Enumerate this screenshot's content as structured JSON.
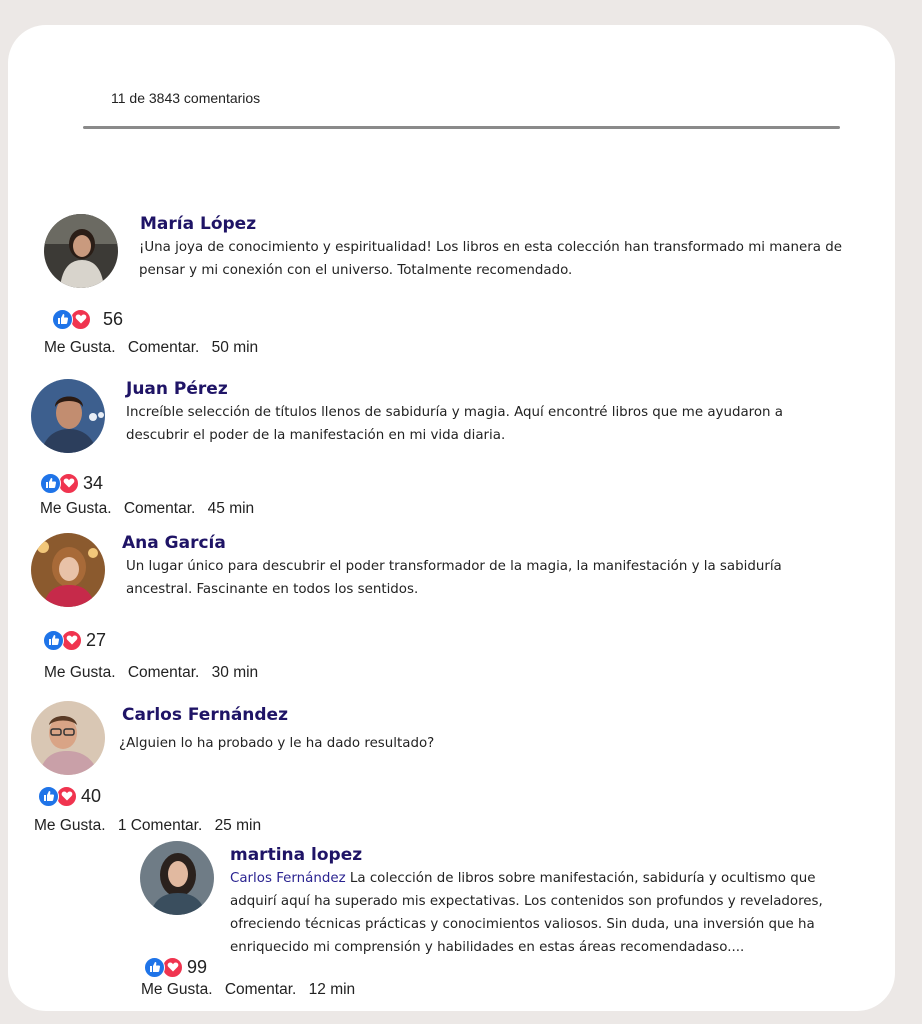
{
  "header": {
    "count_text": "11 de 3843 comentarios"
  },
  "icons": {
    "like": "thumbs-up-icon",
    "love": "heart-icon"
  },
  "colors": {
    "name": "#1f1466",
    "like": "#1f74e8",
    "love": "#f0344f",
    "background": "#ece8e6"
  },
  "comments": [
    {
      "name": "María López",
      "text": "¡Una joya de conocimiento y espiritualidad! Los libros en esta colección han transformado mi manera de pensar y mi conexión con el universo. Totalmente recomendado.",
      "reactions": "56",
      "like": "Me Gusta.",
      "comment": "Comentar.",
      "time": "50 min"
    },
    {
      "name": "Juan Pérez",
      "text": "Increíble selección de títulos llenos de sabiduría y magia. Aquí encontré libros que me ayudaron a descubrir el poder de la manifestación en mi vida diaria.",
      "reactions": "34",
      "like": "Me Gusta.",
      "comment": "Comentar.",
      "time": "45 min"
    },
    {
      "name": "Ana García",
      "text": "Un lugar único para descubrir el poder transformador de la magia, la manifestación y la sabiduría ancestral. Fascinante en todos los sentidos.",
      "reactions": "27",
      "like": "Me Gusta.",
      "comment": "Comentar.",
      "time": "30 min"
    },
    {
      "name": "Carlos Fernández",
      "text": "¿Alguien lo ha probado y le ha dado resultado?",
      "reactions": "40",
      "like": "Me Gusta.",
      "comment": "1 Comentar.",
      "time": "25 min"
    }
  ],
  "reply": {
    "name": "martina lopez",
    "mention": "Carlos Fernández",
    "text": " La colección de libros sobre manifestación, sabiduría y ocultismo que adquirí aquí ha superado mis expectativas. Los contenidos son profundos y reveladores, ofreciendo técnicas prácticas y conocimientos valiosos. Sin duda, una inversión que ha enriquecido mi comprensión y habilidades en estas áreas recomendadaso....",
    "reactions": "99",
    "like": "Me Gusta.",
    "comment": "Comentar.",
    "time": "12 min"
  }
}
